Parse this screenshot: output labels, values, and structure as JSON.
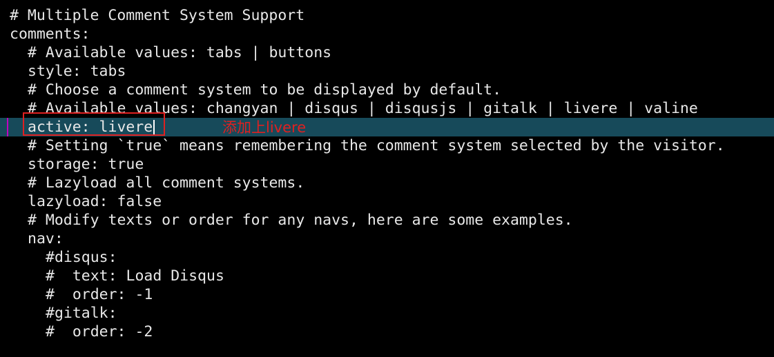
{
  "editor": {
    "lines": [
      "# Multiple Comment System Support",
      "comments:",
      "# Available values: tabs | buttons",
      "style: tabs",
      "# Choose a comment system to be displayed by default.",
      "# Available values: changyan | disqus | disqusjs | gitalk | livere | valine",
      "active: livere",
      "# Setting `true` means remembering the comment system selected by the visitor.",
      "storage: true",
      "# Lazyload all comment systems.",
      "lazyload: false",
      "# Modify texts or order for any navs, here are some examples.",
      "nav:",
      "#disqus:",
      "#  text: Load Disqus",
      "#  order: -1",
      "#gitalk:",
      "#  order: -2"
    ]
  },
  "annotation": {
    "text": "添加上livere",
    "color": "#e02020"
  },
  "colors": {
    "background": "#000000",
    "text": "#e8e8e8",
    "current_line": "#174a5a",
    "highlight_box": "#e02020"
  }
}
